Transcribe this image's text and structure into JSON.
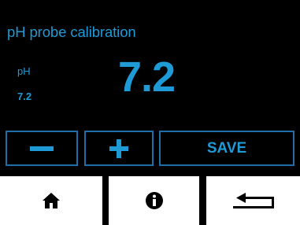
{
  "header": {
    "title": "pH probe calibration"
  },
  "reading": {
    "param_label": "pH",
    "param_value_small": "7.2",
    "param_value_large": "7.2"
  },
  "controls": {
    "decrease_icon": "minus-icon",
    "increase_icon": "plus-icon",
    "save_label": "SAVE"
  },
  "nav": {
    "home_icon": "home-icon",
    "info_icon": "info-icon",
    "back_icon": "return-icon"
  },
  "colors": {
    "background": "#000000",
    "accent": "#1e9ad6",
    "button_border": "#1e6fa8",
    "nav_background": "#ffffff",
    "nav_icon": "#000000"
  }
}
